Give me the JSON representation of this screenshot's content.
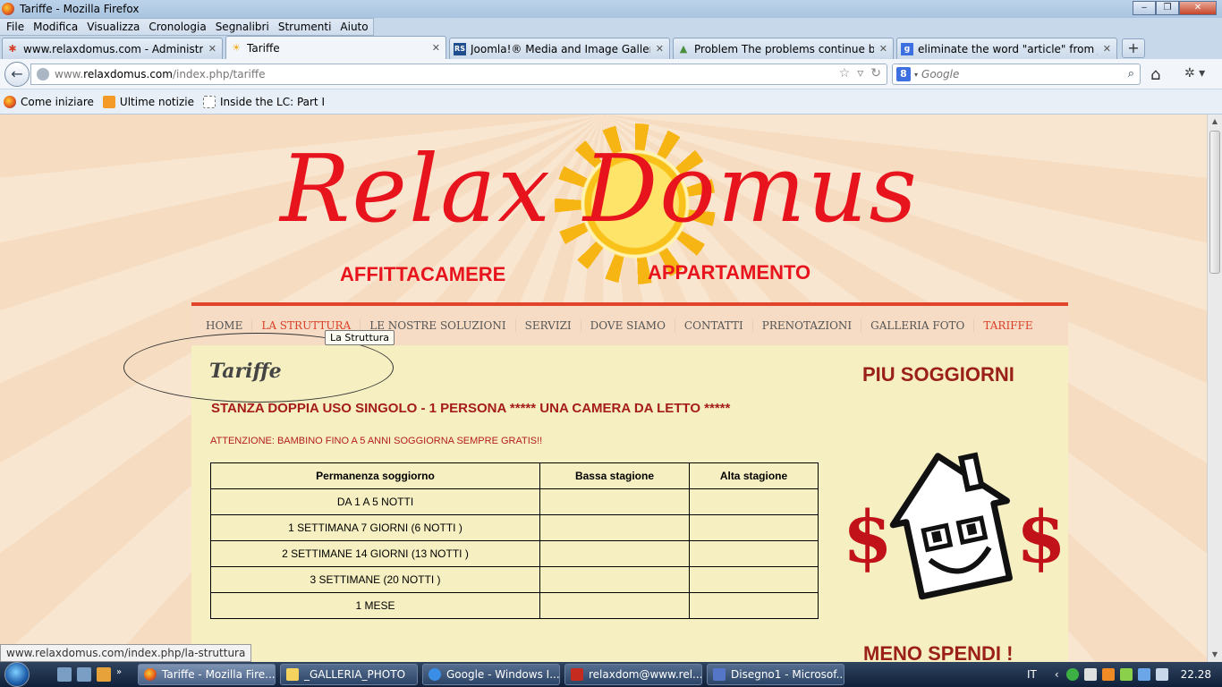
{
  "window": {
    "title": "Tariffe - Mozilla Firefox"
  },
  "menu": [
    "File",
    "Modifica",
    "Visualizza",
    "Cronologia",
    "Segnalibri",
    "Strumenti",
    "Aiuto"
  ],
  "tabs": [
    {
      "label": "www.relaxdomus.com - Administrati...",
      "icon": "joomla-icon"
    },
    {
      "label": "Tariffe",
      "icon": "sun-icon"
    },
    {
      "label": "Joomla!® Media and Image Gallery ...",
      "icon": "rs-icon"
    },
    {
      "label": "Problem The problems continue but ...",
      "icon": "forum-icon"
    },
    {
      "label": "eliminate the word \"article\" from joo...",
      "icon": "google-icon"
    }
  ],
  "url": {
    "prefix": "www.",
    "domain": "relaxdomus.com",
    "path": "/index.php/tariffe"
  },
  "search": {
    "placeholder": "Google",
    "engine_letter": "8"
  },
  "bookmarks": [
    "Come iniziare",
    "Ultime notizie",
    "Inside the LC: Part I"
  ],
  "site": {
    "logo": "Relax Domus",
    "sub_left": "AFFITTACAMERE",
    "sub_right": "APPARTAMENTO",
    "nav": [
      "HOME",
      "LA STRUTTURA",
      "LE NOSTRE SOLUZIONI",
      "SERVIZI",
      "DOVE SIAMO",
      "CONTATTI",
      "PRENOTAZIONI",
      "GALLERIA FOTO",
      "TARIFFE"
    ],
    "tooltip": "La Struttura",
    "page_title": "Tariffe",
    "subtitle": "STANZA DOPPIA USO SINGOLO - 1 PERSONA ***** UNA CAMERA DA LETTO *****",
    "notice": "ATTENZIONE: BAMBINO FINO A 5 ANNI SOGGIORNA SEMPRE GRATIS!!",
    "table": {
      "headers": [
        "Permanenza soggiorno",
        "Bassa stagione",
        "Alta stagione"
      ],
      "rows": [
        [
          "DA 1 A 5 NOTTI",
          "",
          ""
        ],
        [
          "1 SETTIMANA 7 GIORNI (6 NOTTI )",
          "",
          ""
        ],
        [
          "2 SETTIMANE 14 GIORNI (13 NOTTI )",
          "",
          ""
        ],
        [
          "3 SETTIMANE (20 NOTTI )",
          "",
          ""
        ],
        [
          "1 MESE",
          "",
          ""
        ]
      ]
    },
    "side_title": "PIU SOGGIORNI",
    "side_title2": "MENO SPENDI !",
    "dollar": "$"
  },
  "status_url": "www.relaxdomus.com/index.php/la-struttura",
  "taskbar": {
    "tasks": [
      "Tariffe - Mozilla Fire...",
      "_GALLERIA_PHOTO",
      "Google - Windows I...",
      "relaxdom@www.rel...",
      "Disegno1 - Microsof..."
    ],
    "lang": "IT",
    "clock": "22.28"
  },
  "colors": {
    "accent_red": "#e8141d",
    "nav_red": "#d8402a",
    "content_bg": "#f6efc1"
  }
}
